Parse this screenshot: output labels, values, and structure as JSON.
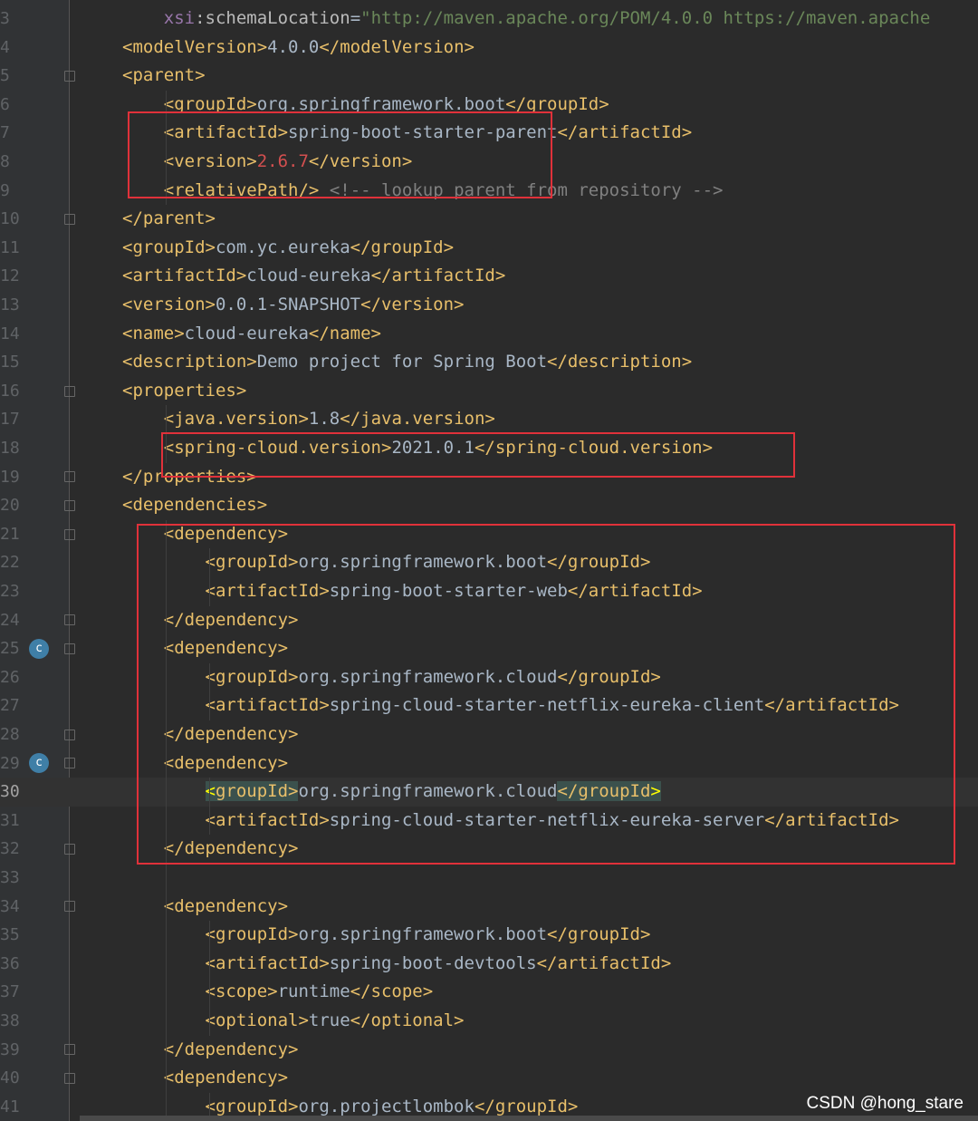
{
  "editor": {
    "lines": [
      {
        "n": "3",
        "html": "    <span class=\"ns\">xsi</span><span class=\"attr\">:schemaLocation</span>=<span class=\"str\">\"http://maven.apache.org/POM/4.0.0 https://maven.apache</span>"
      },
      {
        "n": "4",
        "html": "<span class=\"tag\">&lt;modelVersion&gt;</span>4.0.0<span class=\"tag\">&lt;/modelVersion&gt;</span>"
      },
      {
        "n": "5",
        "html": "<span class=\"tag\">&lt;parent&gt;</span>"
      },
      {
        "n": "6",
        "html": "    <span class=\"tag\">&lt;groupId&gt;</span>org.springframework.boot<span class=\"tag\">&lt;/groupId&gt;</span>"
      },
      {
        "n": "7",
        "html": "    <span class=\"tag\">&lt;artifactId&gt;</span>spring-boot-starter-parent<span class=\"tag\">&lt;/artifactId&gt;</span>"
      },
      {
        "n": "8",
        "html": "    <span class=\"tag\">&lt;version&gt;</span><span class=\"red\">2.6.7</span><span class=\"tag\">&lt;/version&gt;</span>"
      },
      {
        "n": "9",
        "html": "    <span class=\"tag\">&lt;relativePath/&gt;</span> <span class=\"cmt\">&lt;!-- lookup parent from repository --&gt;</span>"
      },
      {
        "n": "10",
        "html": "<span class=\"tag\">&lt;/parent&gt;</span>"
      },
      {
        "n": "11",
        "html": "<span class=\"tag\">&lt;groupId&gt;</span>com.yc.eureka<span class=\"tag\">&lt;/groupId&gt;</span>"
      },
      {
        "n": "12",
        "html": "<span class=\"tag\">&lt;artifactId&gt;</span>cloud-eureka<span class=\"tag\">&lt;/artifactId&gt;</span>"
      },
      {
        "n": "13",
        "html": "<span class=\"tag\">&lt;version&gt;</span>0.0.1-SNAPSHOT<span class=\"tag\">&lt;/version&gt;</span>"
      },
      {
        "n": "14",
        "html": "<span class=\"tag\">&lt;name&gt;</span>cloud-eureka<span class=\"tag\">&lt;/name&gt;</span>"
      },
      {
        "n": "15",
        "html": "<span class=\"tag\">&lt;description&gt;</span>Demo project for Spring Boot<span class=\"tag\">&lt;/description&gt;</span>"
      },
      {
        "n": "16",
        "html": "<span class=\"tag\">&lt;properties&gt;</span>"
      },
      {
        "n": "17",
        "html": "    <span class=\"tag\">&lt;java.version&gt;</span>1.8<span class=\"tag\">&lt;/java.version&gt;</span>"
      },
      {
        "n": "18",
        "html": "    <span class=\"tag\">&lt;spring-cloud.version&gt;</span>2021.0.1<span class=\"tag\">&lt;/spring-cloud.version&gt;</span>"
      },
      {
        "n": "19",
        "html": "<span class=\"tag\">&lt;/properties&gt;</span>"
      },
      {
        "n": "20",
        "html": "<span class=\"tag\">&lt;dependencies&gt;</span>"
      },
      {
        "n": "21",
        "html": "    <span class=\"tag\">&lt;dependency&gt;</span>"
      },
      {
        "n": "22",
        "html": "        <span class=\"tag\">&lt;groupId&gt;</span>org.springframework.boot<span class=\"tag\">&lt;/groupId&gt;</span>"
      },
      {
        "n": "23",
        "html": "        <span class=\"tag\">&lt;artifactId&gt;</span>spring-boot-starter-web<span class=\"tag\">&lt;/artifactId&gt;</span>"
      },
      {
        "n": "24",
        "html": "    <span class=\"tag\">&lt;/dependency&gt;</span>"
      },
      {
        "n": "25",
        "html": "    <span class=\"tag\">&lt;dependency&gt;</span>"
      },
      {
        "n": "26",
        "html": "        <span class=\"tag\">&lt;groupId&gt;</span>org.springframework.cloud<span class=\"tag\">&lt;/groupId&gt;</span>"
      },
      {
        "n": "27",
        "html": "        <span class=\"tag\">&lt;artifactId&gt;</span>spring-cloud-starter-netflix-eureka-client<span class=\"tag\">&lt;/artifactId&gt;</span>"
      },
      {
        "n": "28",
        "html": "    <span class=\"tag\">&lt;/dependency&gt;</span>"
      },
      {
        "n": "29",
        "html": "    <span class=\"tag\">&lt;dependency&gt;</span>"
      },
      {
        "n": "30",
        "html": "        <span class=\"hl\"><span class=\"hl-yellow\">&lt;</span>groupId&gt;</span>org.springframework.cloud<span class=\"hl\">&lt;/groupId<span class=\"hl-yellow\">&gt;</span></span>"
      },
      {
        "n": "31",
        "html": "        <span class=\"tag\">&lt;artifactId&gt;</span>spring-cloud-starter-netflix-eureka-server<span class=\"tag\">&lt;/artifactId&gt;</span>"
      },
      {
        "n": "32",
        "html": "    <span class=\"tag\">&lt;/dependency&gt;</span>"
      },
      {
        "n": "33",
        "html": ""
      },
      {
        "n": "34",
        "html": "    <span class=\"tag\">&lt;dependency&gt;</span>"
      },
      {
        "n": "35",
        "html": "        <span class=\"tag\">&lt;groupId&gt;</span>org.springframework.boot<span class=\"tag\">&lt;/groupId&gt;</span>"
      },
      {
        "n": "36",
        "html": "        <span class=\"tag\">&lt;artifactId&gt;</span>spring-boot-devtools<span class=\"tag\">&lt;/artifactId&gt;</span>"
      },
      {
        "n": "37",
        "html": "        <span class=\"tag\">&lt;scope&gt;</span>runtime<span class=\"tag\">&lt;/scope&gt;</span>"
      },
      {
        "n": "38",
        "html": "        <span class=\"tag\">&lt;optional&gt;</span>true<span class=\"tag\">&lt;/optional&gt;</span>"
      },
      {
        "n": "39",
        "html": "    <span class=\"tag\">&lt;/dependency&gt;</span>"
      },
      {
        "n": "40",
        "html": "    <span class=\"tag\">&lt;dependency&gt;</span>"
      },
      {
        "n": "41",
        "html": "        <span class=\"tag\">&lt;groupId&gt;</span>org.projectlombok<span class=\"tag\">&lt;/groupId&gt;</span>"
      }
    ],
    "current_line": "30",
    "fold_lines": [
      "5",
      "10",
      "16",
      "19",
      "20",
      "21",
      "24",
      "25",
      "28",
      "29",
      "32",
      "34",
      "39",
      "40"
    ],
    "gutter_icon_lines": [
      "25",
      "29"
    ],
    "gutter_icon_symbol": "c"
  },
  "watermark": "CSDN @hong_stare",
  "colors": {
    "annotation_box": "#e0313a",
    "background": "#2b2b2b"
  }
}
